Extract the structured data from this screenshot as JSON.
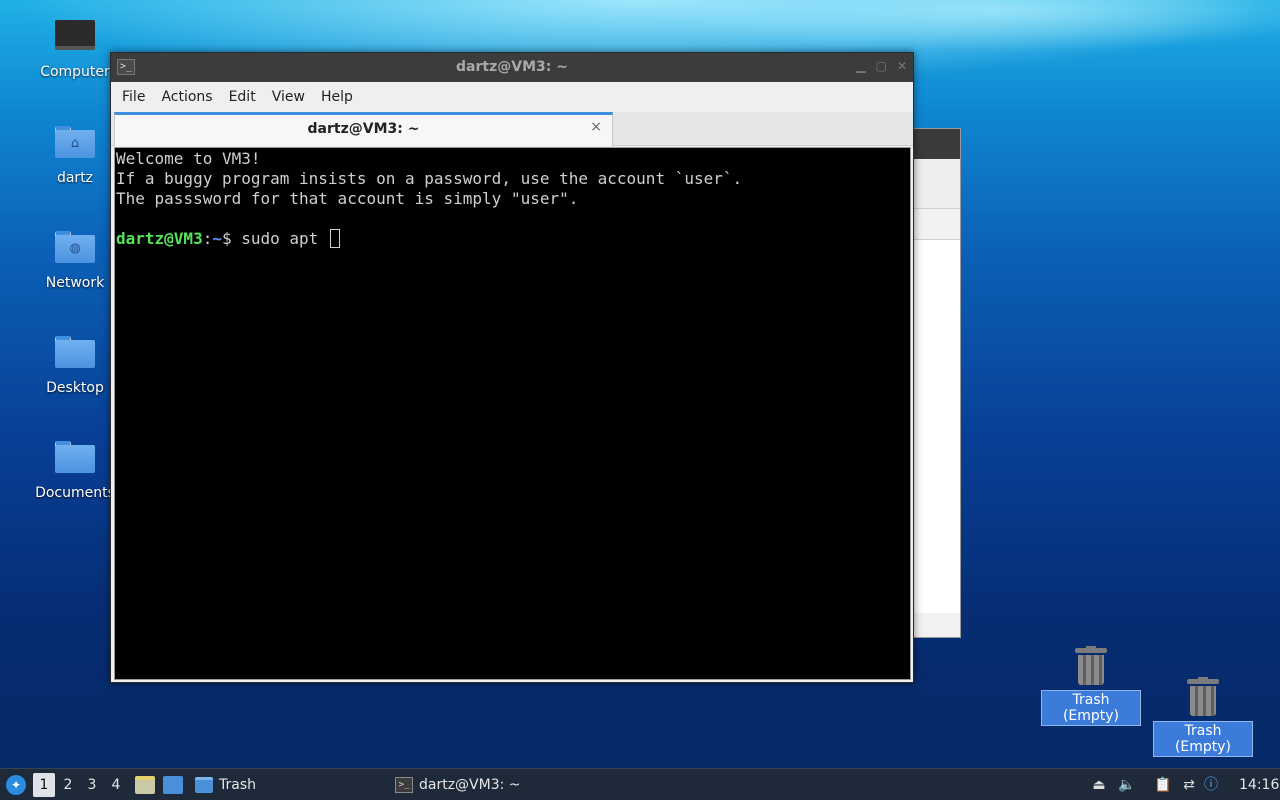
{
  "desktop": {
    "icons": [
      {
        "label": "Computer",
        "icon": "computer-icon"
      },
      {
        "label": "dartz",
        "icon": "home-folder-icon"
      },
      {
        "label": "Network",
        "icon": "network-folder-icon"
      },
      {
        "label": "Desktop",
        "icon": "folder-icon"
      },
      {
        "label": "Documents",
        "icon": "folder-icon"
      }
    ],
    "trash_items": [
      {
        "label": "Trash (Empty)",
        "icon": "trash-icon"
      },
      {
        "label": "Trash (Empty)",
        "icon": "trash-icon"
      }
    ]
  },
  "terminal_window": {
    "title": "dartz@VM3: ~",
    "menu": [
      "File",
      "Actions",
      "Edit",
      "View",
      "Help"
    ],
    "tab_title": "dartz@VM3: ~",
    "tab_close": "×",
    "lines": [
      "Welcome to VM3!",
      "If a buggy program insists on a password, use the account `user`.",
      "The passsword for that account is simply \"user\"."
    ],
    "prompt_user": "dartz@VM3",
    "prompt_sep": ":",
    "prompt_path": "~",
    "prompt_symbol": "$ ",
    "command": "sudo apt "
  },
  "taskbar": {
    "workspaces": [
      "1",
      "2",
      "3",
      "4"
    ],
    "active_workspace": "1",
    "tasks": [
      {
        "label": "Trash",
        "icon": "folder-icon"
      },
      {
        "label": "dartz@VM3: ~",
        "icon": "terminal-icon"
      }
    ],
    "clock": "14:16"
  },
  "colors": {
    "prompt_user": "#55e35a",
    "prompt_path": "#6b8cff",
    "tab_accent": "#3d8fe0",
    "taskbar": "#1e2a3a"
  }
}
